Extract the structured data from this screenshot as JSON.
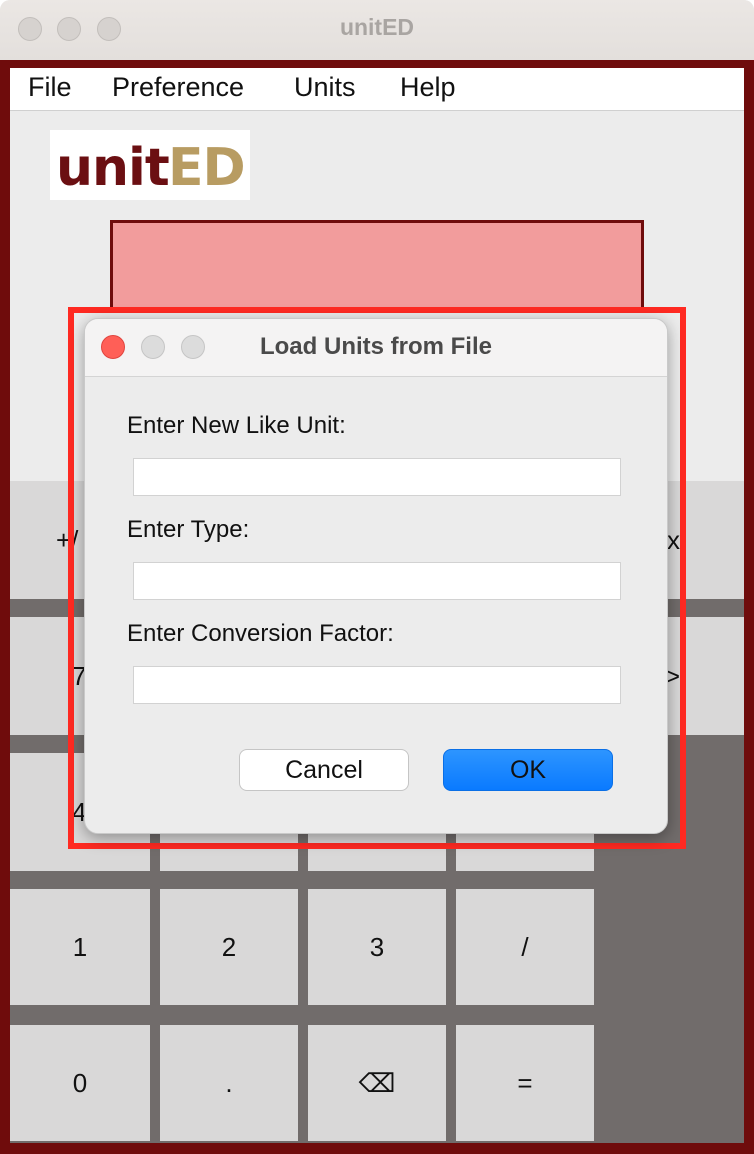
{
  "window": {
    "title": "unitED"
  },
  "menu": {
    "items": [
      "File",
      "Preference",
      "Units",
      "Help"
    ]
  },
  "logo": {
    "part1": "unit",
    "part2": "ED",
    "color1": "#6b0f12",
    "color2": "#b89c62"
  },
  "keypad": {
    "partial": [
      "+/",
      "x",
      "7",
      ">",
      "4"
    ],
    "row4": [
      "1",
      "2",
      "3",
      "/"
    ],
    "row5": [
      "0",
      ".",
      "⌫",
      "="
    ]
  },
  "dialog": {
    "title": "Load Units from File",
    "fields": [
      {
        "label": "Enter New Like Unit:",
        "value": ""
      },
      {
        "label": "Enter Type:",
        "value": ""
      },
      {
        "label": "Enter Conversion Factor:",
        "value": ""
      }
    ],
    "cancel_label": "Cancel",
    "ok_label": "OK"
  },
  "colors": {
    "frame": "#6f0c0c",
    "display": "#f29c9c",
    "highlight": "#ff2a22",
    "ok_button": "#0a7aff",
    "close_light": "#ff5f57"
  }
}
